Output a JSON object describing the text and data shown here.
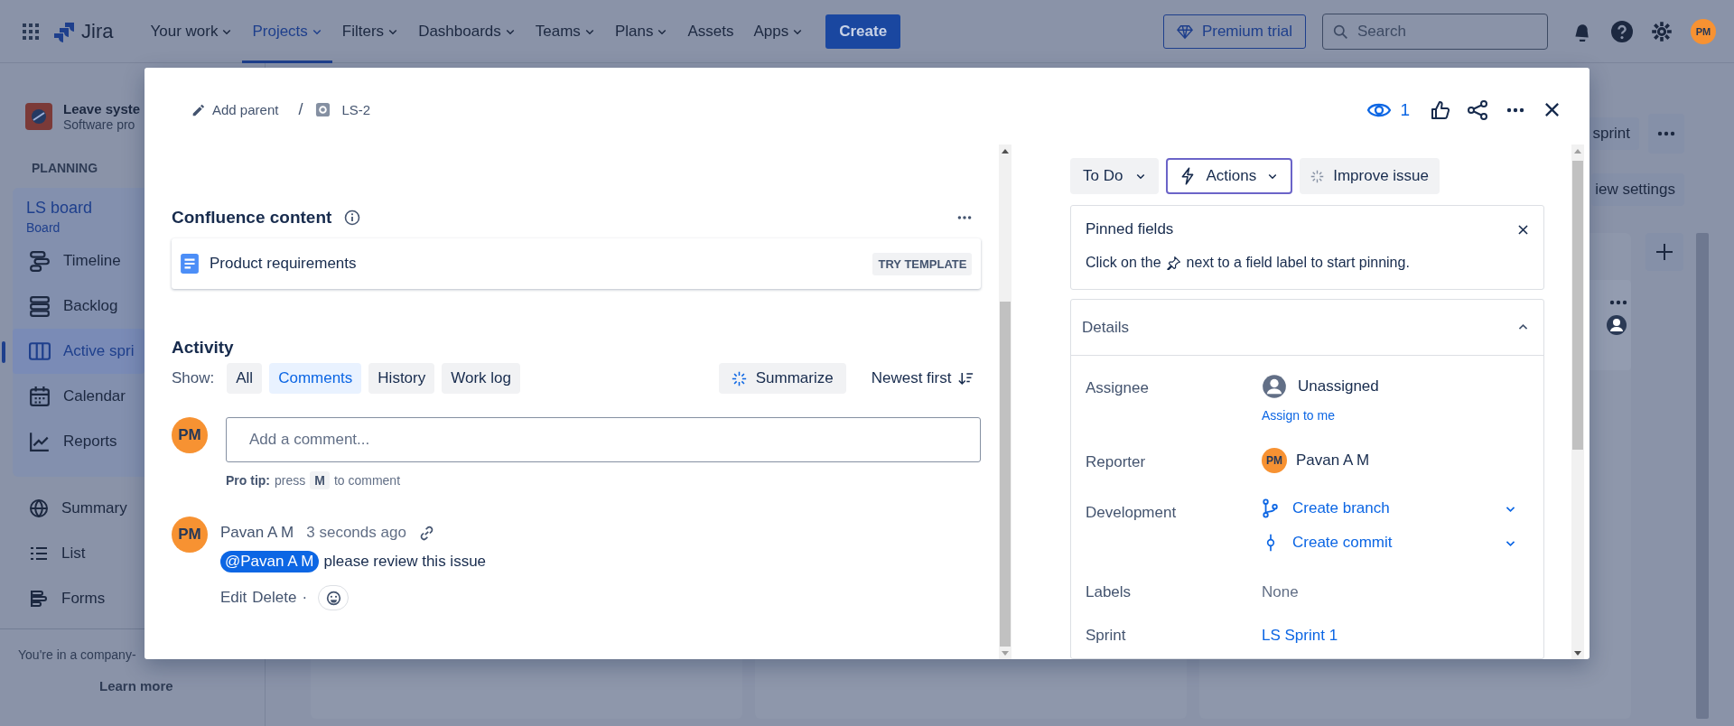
{
  "topbar": {
    "product": "Jira",
    "nav": [
      {
        "label": "Your work",
        "dropdown": true,
        "selected": false
      },
      {
        "label": "Projects",
        "dropdown": true,
        "selected": true
      },
      {
        "label": "Filters",
        "dropdown": true,
        "selected": false
      },
      {
        "label": "Dashboards",
        "dropdown": true,
        "selected": false
      },
      {
        "label": "Teams",
        "dropdown": true,
        "selected": false
      },
      {
        "label": "Plans",
        "dropdown": true,
        "selected": false
      },
      {
        "label": "Assets",
        "dropdown": false,
        "selected": false
      },
      {
        "label": "Apps",
        "dropdown": true,
        "selected": false
      }
    ],
    "create": "Create",
    "premium": "Premium trial",
    "search": {
      "placeholder": "Search"
    },
    "avatar": "PM"
  },
  "sidebar": {
    "project": "Leave syste",
    "project_type": "Software pro",
    "section": "PLANNING",
    "board": {
      "title": "LS board",
      "subtitle": "Board"
    },
    "planning_items": [
      {
        "label": "Timeline",
        "kind": "timeline",
        "selected": false
      },
      {
        "label": "Backlog",
        "kind": "backlog",
        "selected": false
      },
      {
        "label": "Active spri",
        "kind": "board",
        "selected": true
      },
      {
        "label": "Calendar",
        "kind": "calendar",
        "selected": false
      },
      {
        "label": "Reports",
        "kind": "reports",
        "selected": false
      }
    ],
    "items": [
      {
        "label": "Summary",
        "kind": "globe"
      },
      {
        "label": "List",
        "kind": "list"
      },
      {
        "label": "Forms",
        "kind": "forms"
      }
    ],
    "notice": "You're in a company-",
    "learn_more": "Learn more"
  },
  "board": {
    "sprint_button": "sprint",
    "view_settings": "iew settings"
  },
  "modal": {
    "breadcrumb": {
      "add_parent": "Add parent",
      "separator": "/",
      "issue_key": "LS-2"
    },
    "watchers": "1",
    "confluence": {
      "title": "Confluence content",
      "item": "Product requirements",
      "action": "TRY TEMPLATE"
    },
    "activity": {
      "title": "Activity",
      "show_label": "Show:",
      "filters": [
        {
          "label": "All",
          "selected": false
        },
        {
          "label": "Comments",
          "selected": true
        },
        {
          "label": "History",
          "selected": false
        },
        {
          "label": "Work log",
          "selected": false
        }
      ],
      "summarize": "Summarize",
      "sort": "Newest first",
      "comment_box": {
        "avatar": "PM",
        "placeholder": "Add a comment..."
      },
      "pro_tip": {
        "lead": "Pro tip:",
        "before": "press",
        "key": "M",
        "after": "to comment"
      },
      "comments": [
        {
          "avatar": "PM",
          "author": "Pavan A M",
          "time": "3 seconds ago",
          "mention": "@Pavan A M",
          "text": "please review this issue",
          "actions": [
            "Edit",
            "Delete"
          ],
          "separator": "·"
        }
      ]
    },
    "side": {
      "status": "To Do",
      "actions": "Actions",
      "improve": "Improve issue",
      "pinned": {
        "title": "Pinned fields",
        "before": "Click on the",
        "after": "next to a field label to start pinning."
      },
      "details": {
        "title": "Details",
        "expanded": true,
        "fields": [
          {
            "label": "Assignee",
            "kind": "unassigned",
            "value": "Unassigned",
            "link": "Assign to me"
          },
          {
            "label": "Reporter",
            "kind": "user",
            "avatar": "PM",
            "value": "Pavan A M"
          },
          {
            "label": "Development",
            "kind": "dev",
            "links": [
              {
                "label": "Create branch",
                "kind": "branch"
              },
              {
                "label": "Create commit",
                "kind": "commit"
              }
            ]
          },
          {
            "label": "Labels",
            "kind": "empty",
            "value": "None"
          },
          {
            "label": "Sprint",
            "kind": "link",
            "value": "LS Sprint 1"
          }
        ]
      }
    }
  }
}
